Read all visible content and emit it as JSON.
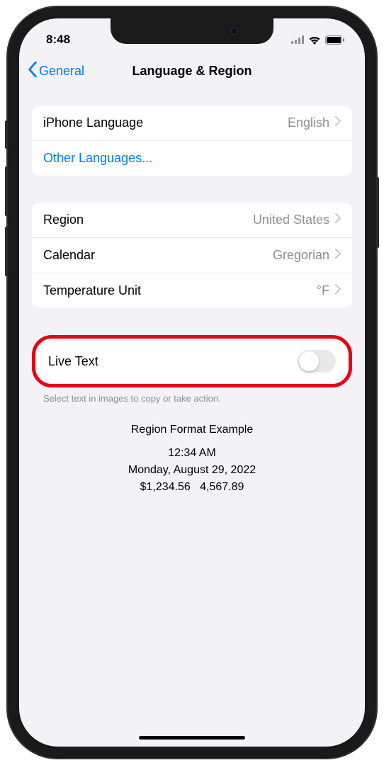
{
  "status": {
    "time": "8:48"
  },
  "nav": {
    "back_label": "General",
    "title": "Language & Region"
  },
  "group1": {
    "iphone_language_label": "iPhone Language",
    "iphone_language_value": "English",
    "other_languages_label": "Other Languages..."
  },
  "group2": {
    "region_label": "Region",
    "region_value": "United States",
    "calendar_label": "Calendar",
    "calendar_value": "Gregorian",
    "temperature_label": "Temperature Unit",
    "temperature_value": "°F"
  },
  "group3": {
    "live_text_label": "Live Text",
    "live_text_on": false,
    "live_text_description": "Select text in images to copy or take action."
  },
  "example": {
    "header": "Region Format Example",
    "time": "12:34 AM",
    "date": "Monday, August 29, 2022",
    "currency": "$1,234.56",
    "number": "4,567.89"
  }
}
